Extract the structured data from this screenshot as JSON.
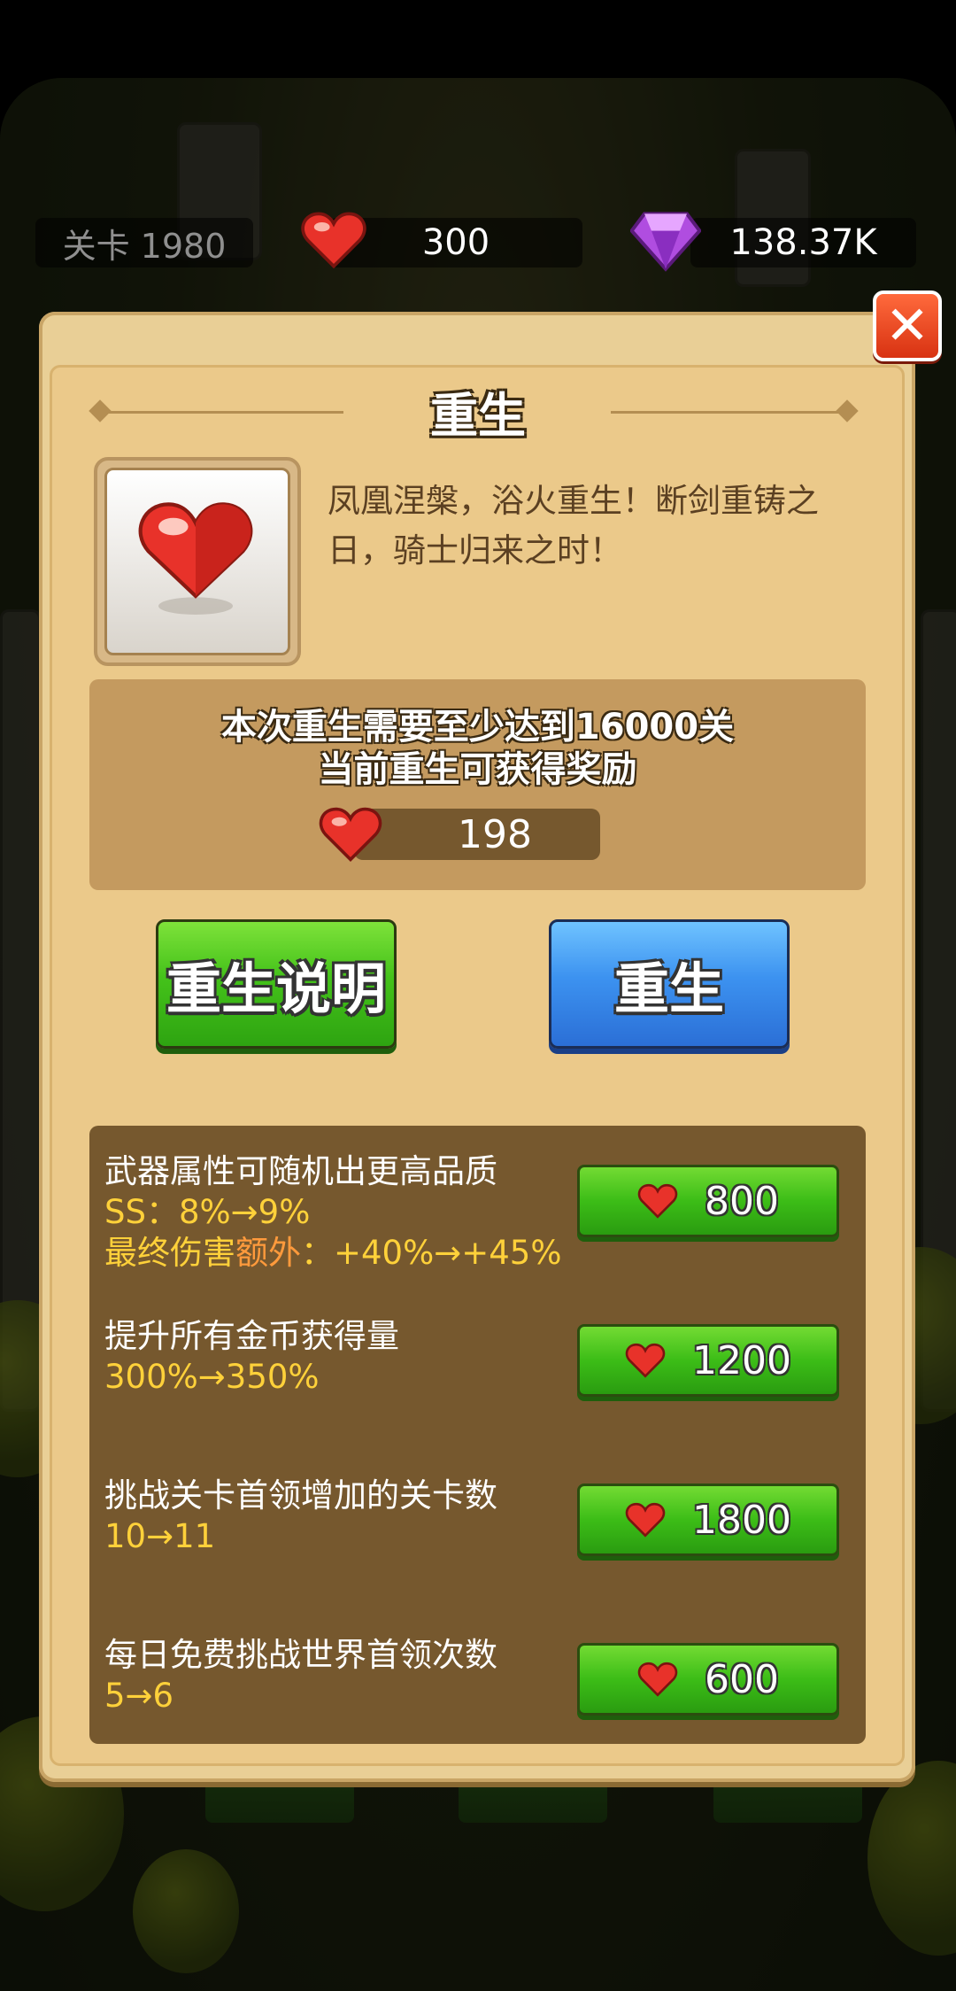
{
  "hud": {
    "level_label": "关卡 1980",
    "hearts": "300",
    "gems": "138.37K"
  },
  "dialog": {
    "title": "重生",
    "description": "凤凰涅槃，浴火重生！断剑重铸之日，骑士归来之时！",
    "requirement_line1": "本次重生需要至少达到16000关",
    "requirement_line2": "当前重生可获得奖励",
    "reward_hearts": "198",
    "info_button_label": "重生说明",
    "rebirth_button_label": "重生"
  },
  "upgrades": [
    {
      "title": "武器属性可随机出更高品质",
      "line2": "SS：8%→9%",
      "line3_prefix": "最终伤害",
      "line3_highlight": "额外",
      "line3_suffix": "：+40%→+45%",
      "cost": "800"
    },
    {
      "title": "提升所有金币获得量",
      "line2": "300%→350%",
      "cost": "1200"
    },
    {
      "title": "挑战关卡首领增加的关卡数",
      "line2": "10→11",
      "cost": "1800"
    },
    {
      "title": "每日免费挑战世界首领次数",
      "line2": "5→6",
      "cost": "600"
    }
  ],
  "colors": {
    "heart": "#e8322a",
    "gem": "#b04de0",
    "green_button": "#3cbd17",
    "blue_button": "#3c92f0",
    "highlight_yellow": "#ffd13a"
  }
}
